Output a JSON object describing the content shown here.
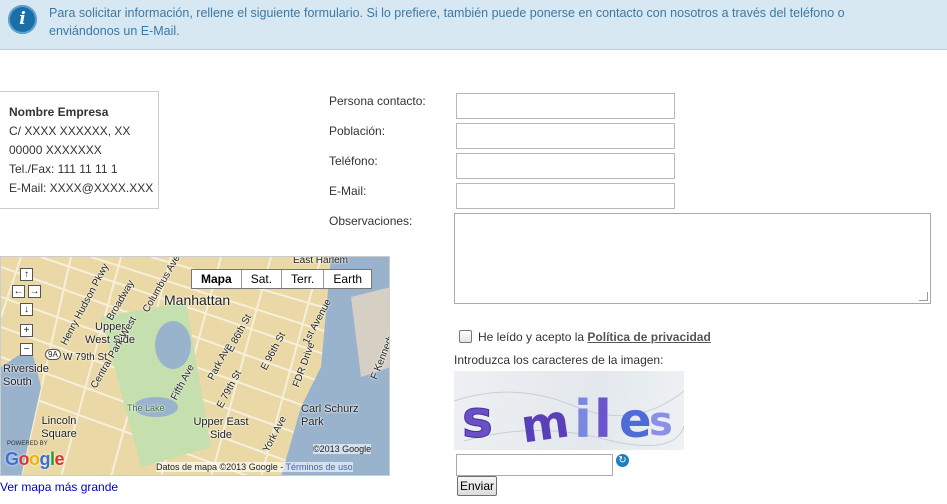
{
  "info": {
    "text": "Para solicitar información, rellene el siguiente formulario. Si lo prefiere, también puede ponerse en contacto con nosotros  a través del teléfono o enviándonos un E-Mail.",
    "icon": "info-icon",
    "icon_glyph": "i",
    "color": "#3b78a6"
  },
  "company": {
    "name": "Nombre Empresa",
    "address": "C/ XXXX XXXXXX, XX",
    "postal": "00000 XXXXXXX",
    "phone": "Tel./Fax: 111 11 11 1",
    "email": "E-Mail: XXXX@XXXX.XXX"
  },
  "form": {
    "contact_label": "Persona contacto:",
    "city_label": "Población:",
    "phone_label": "Teléfono:",
    "email_label": "E-Mail:",
    "notes_label": "Observaciones:",
    "contact_value": "",
    "city_value": "",
    "phone_value": "",
    "email_value": "",
    "notes_value": "",
    "privacy_prefix": "He leído y acepto la ",
    "privacy_link": "Política de privacidad",
    "privacy_checked": false,
    "captcha_label": "Introduzca los caracteres de la imagen:",
    "captcha_text": "smiles",
    "captcha_value": "",
    "refresh_icon": "refresh-icon",
    "send_label": "Enviar"
  },
  "map": {
    "types": [
      "Mapa",
      "Sat.",
      "Terr.",
      "Earth"
    ],
    "active_type": "Mapa",
    "labels": [
      "Manhattan",
      "Upper West Side",
      "Upper East Side",
      "Central Park West",
      "Columbus Ave",
      "Broadway",
      "Henry Hudson Pkwy",
      "W 79th St",
      "Riverside South",
      "Lincoln Square",
      "The Lake",
      "Park Ave",
      "Fifth Ave",
      "E 86th St",
      "E 79th St",
      "E 96th St",
      "1st Avenue",
      "York Ave",
      "FDR Drive",
      "Carl Schurz Park",
      "East Harlem",
      "F Kennedy B"
    ],
    "copyright": "©2013 Google",
    "data_notice": "Datos de mapa ©2013 Google - ",
    "terms_link": "Términos de uso",
    "powered_by": "POWERED BY",
    "logo": "Google",
    "route_badge": "9A",
    "bigger_map_link": "Ver mapa más grande",
    "nav_icons": [
      "pan-up-icon",
      "pan-left-icon",
      "pan-right-icon",
      "pan-down-icon",
      "zoom-in-icon",
      "zoom-out-icon"
    ],
    "water_color": "#99b3cc",
    "park_color": "#c5dfae"
  }
}
